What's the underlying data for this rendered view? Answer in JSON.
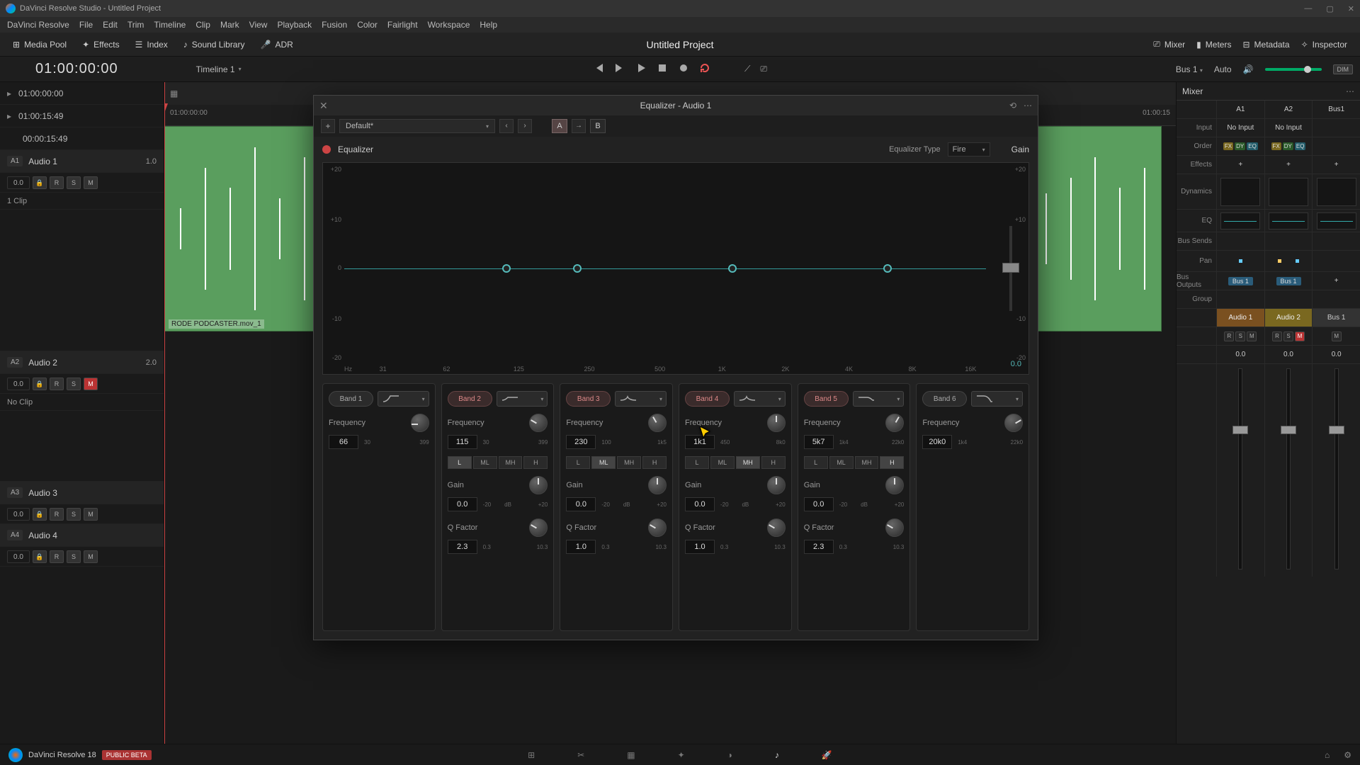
{
  "window_title": "DaVinci Resolve Studio - Untitled Project",
  "menus": [
    "DaVinci Resolve",
    "File",
    "Edit",
    "Trim",
    "Timeline",
    "Clip",
    "Mark",
    "View",
    "Playback",
    "Fusion",
    "Color",
    "Fairlight",
    "Workspace",
    "Help"
  ],
  "toolbar": {
    "media_pool": "Media Pool",
    "effects": "Effects",
    "index": "Index",
    "sound_library": "Sound Library",
    "adr": "ADR",
    "project": "Untitled Project",
    "mixer": "Mixer",
    "meters": "Meters",
    "metadata": "Metadata",
    "inspector": "Inspector"
  },
  "sec_row": {
    "timecode": "01:00:00:00",
    "timeline": "Timeline 1",
    "bus": "Bus 1",
    "auto": "Auto",
    "dim": "DIM"
  },
  "markers": [
    {
      "tc": "01:00:00:00"
    },
    {
      "tc": "01:00:15:49"
    },
    {
      "tc": "00:00:15:49"
    }
  ],
  "tracks": [
    {
      "id": "A1",
      "name": "Audio 1",
      "pan": "1.0",
      "vol": "0.0",
      "clips": "1 Clip",
      "clip_label": "RODE PODCASTER.mov_1",
      "mute": false
    },
    {
      "id": "A2",
      "name": "Audio 2",
      "pan": "2.0",
      "vol": "0.0",
      "clips": "No Clip",
      "mute": true
    },
    {
      "id": "A3",
      "name": "Audio 3",
      "pan": "",
      "vol": "0.0",
      "clips": "",
      "mute": false
    },
    {
      "id": "A4",
      "name": "Audio 4",
      "pan": "",
      "vol": "0.0",
      "clips": "",
      "mute": false
    }
  ],
  "tl": {
    "tc_left": "01:00:00:00",
    "tc_right": "01:00:15"
  },
  "eq": {
    "title": "Equalizer - Audio 1",
    "preset": "Default*",
    "a": "A",
    "b": "B",
    "name": "Equalizer",
    "type_label": "Equalizer Type",
    "type": "Fire",
    "gain_label": "Gain",
    "gain_val": "0.0",
    "y": [
      "+20",
      "+10",
      "0",
      "-10",
      "-20"
    ],
    "y2": [
      "+20",
      "+10",
      "",
      "-10",
      "-20"
    ],
    "x": [
      "Hz",
      "31",
      "62",
      "125",
      "250",
      "500",
      "1K",
      "2K",
      "4K",
      "8K",
      "16K"
    ],
    "bands": [
      {
        "label": "Band 1",
        "on": false,
        "shape": "hp",
        "freq_label": "Frequency",
        "freq": "66",
        "lo": "30",
        "hi": "399"
      },
      {
        "label": "Band 2",
        "on": true,
        "shape": "ls",
        "freq_label": "Frequency",
        "freq": "115",
        "lo": "30",
        "hi": "399",
        "sel": "L",
        "gain_label": "Gain",
        "gain": "0.0",
        "glo": "-20",
        "gmid": "dB",
        "ghi": "+20",
        "q_label": "Q Factor",
        "q": "2.3",
        "qlo": "0.3",
        "qhi": "10.3"
      },
      {
        "label": "Band 3",
        "on": true,
        "shape": "bell",
        "freq_label": "Frequency",
        "freq": "230",
        "lo": "100",
        "hi": "1k5",
        "sel": "ML",
        "gain_label": "Gain",
        "gain": "0.0",
        "glo": "-20",
        "gmid": "dB",
        "ghi": "+20",
        "q_label": "Q Factor",
        "q": "1.0",
        "qlo": "0.3",
        "qhi": "10.3"
      },
      {
        "label": "Band 4",
        "on": true,
        "shape": "bell",
        "freq_label": "Frequency",
        "freq": "1k1",
        "lo": "450",
        "hi": "8k0",
        "sel": "MH",
        "gain_label": "Gain",
        "gain": "0.0",
        "glo": "-20",
        "gmid": "dB",
        "ghi": "+20",
        "q_label": "Q Factor",
        "q": "1.0",
        "qlo": "0.3",
        "qhi": "10.3"
      },
      {
        "label": "Band 5",
        "on": true,
        "shape": "hs",
        "freq_label": "Frequency",
        "freq": "5k7",
        "lo": "1k4",
        "hi": "22k0",
        "sel": "H",
        "gain_label": "Gain",
        "gain": "0.0",
        "glo": "-20",
        "gmid": "dB",
        "ghi": "+20",
        "q_label": "Q Factor",
        "q": "2.3",
        "qlo": "0.3",
        "qhi": "10.3"
      },
      {
        "label": "Band 6",
        "on": false,
        "shape": "lp",
        "freq_label": "Frequency",
        "freq": "20k0",
        "lo": "1k4",
        "hi": "22k0"
      }
    ],
    "fp": [
      "L",
      "ML",
      "MH",
      "H"
    ]
  },
  "mixer": {
    "title": "Mixer",
    "chans": [
      "A1",
      "A2",
      "Bus1"
    ],
    "rows": {
      "input": "Input",
      "input_v": [
        "No Input",
        "No Input",
        ""
      ],
      "order": "Order",
      "fx": "FX",
      "dy": "DY",
      "eqp": "EQ",
      "effects": "Effects",
      "dynamics": "Dynamics",
      "eq": "EQ",
      "bus_sends": "Bus Sends",
      "pan": "Pan",
      "bus_outputs": "Bus Outputs",
      "bus_v": [
        "Bus 1",
        "Bus 1",
        ""
      ],
      "group": "Group",
      "names": [
        "Audio 1",
        "Audio 2",
        "Bus 1"
      ],
      "db": [
        "0.0",
        "0.0",
        "0.0"
      ]
    }
  },
  "footer": {
    "ver": "DaVinci Resolve 18",
    "beta": "PUBLIC BETA"
  }
}
